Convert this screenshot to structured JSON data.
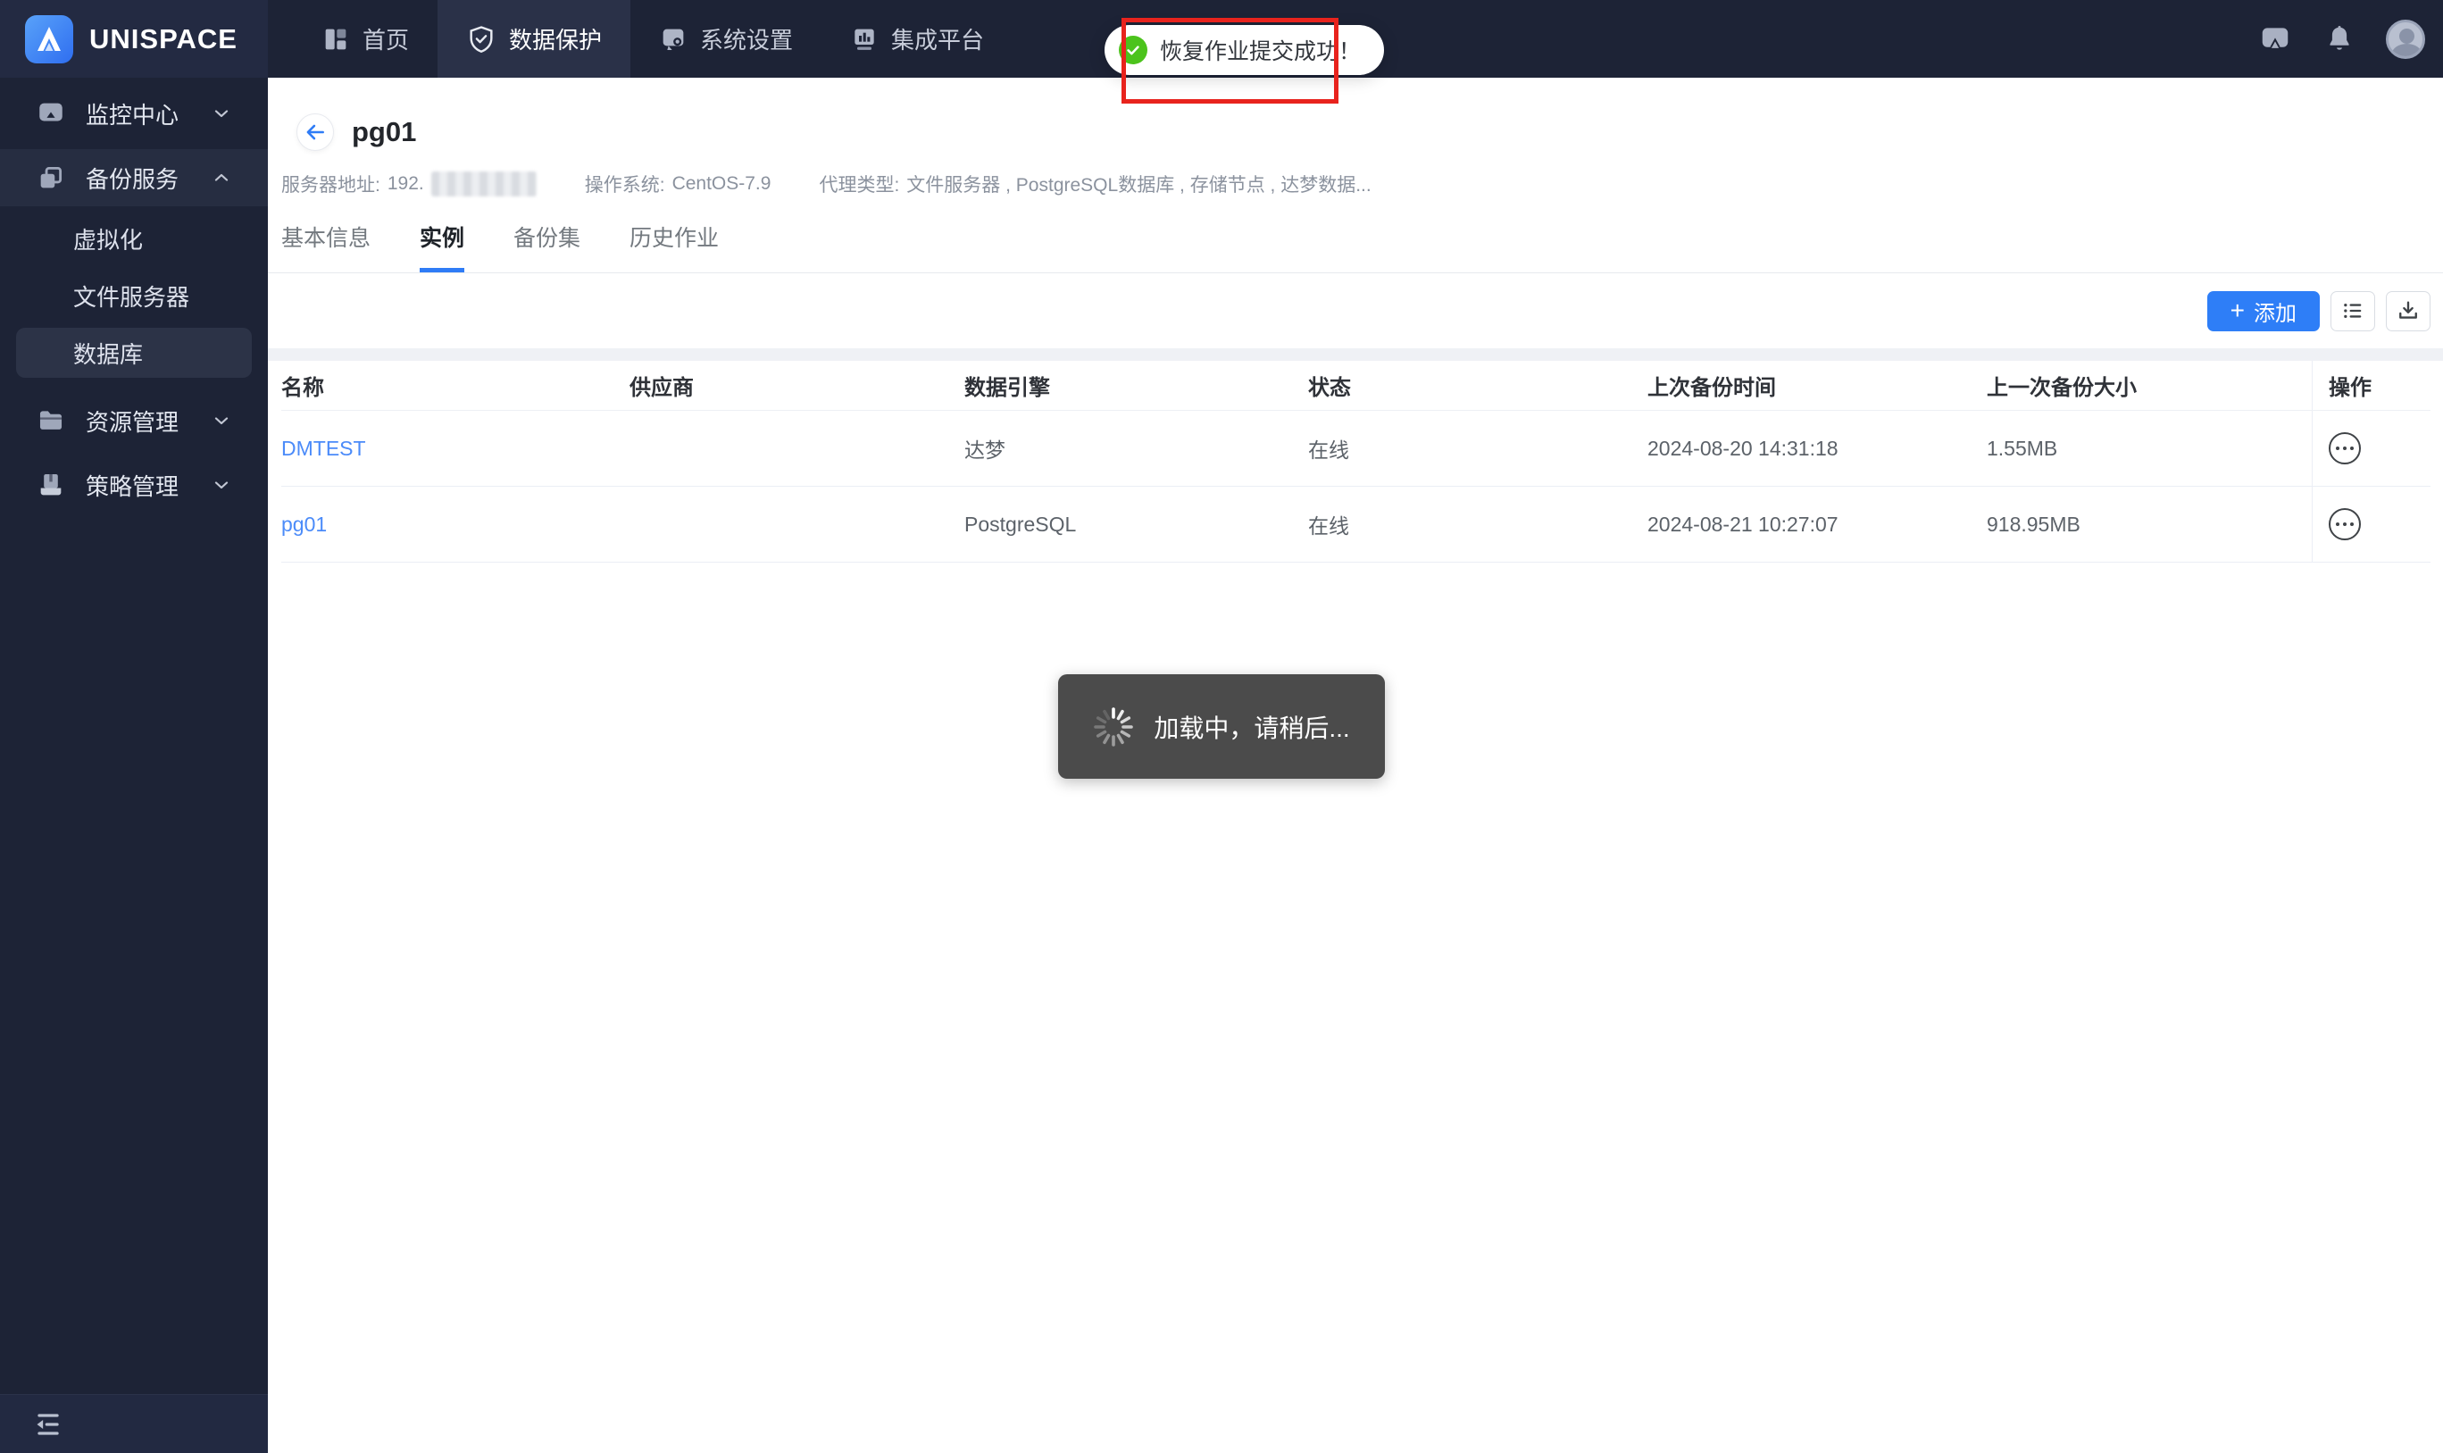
{
  "brand": {
    "name": "UNISPACE"
  },
  "topnav": {
    "items": [
      {
        "label": "首页",
        "active": false
      },
      {
        "label": "数据保护",
        "active": true
      },
      {
        "label": "系统设置",
        "active": false
      },
      {
        "label": "集成平台",
        "active": false
      }
    ]
  },
  "toast": {
    "message": "恢复作业提交成功！"
  },
  "sidebar": {
    "groups": [
      {
        "label": "监控中心",
        "state": "collapsed"
      },
      {
        "label": "备份服务",
        "state": "expanded",
        "children": [
          {
            "label": "虚拟化",
            "active": false
          },
          {
            "label": "文件服务器",
            "active": false
          },
          {
            "label": "数据库",
            "active": true
          }
        ]
      },
      {
        "label": "资源管理",
        "state": "collapsed"
      },
      {
        "label": "策略管理",
        "state": "collapsed"
      }
    ]
  },
  "page": {
    "title": "pg01",
    "info": {
      "server_label": "服务器地址:",
      "server_value_visible": "192.",
      "server_value_censored": true,
      "os_label": "操作系统:",
      "os_value": "CentOS-7.9",
      "agent_label": "代理类型:",
      "agent_value": "文件服务器 , PostgreSQL数据库 , 存储节点 , 达梦数据..."
    },
    "tabs": [
      {
        "label": "基本信息",
        "active": false
      },
      {
        "label": "实例",
        "active": true
      },
      {
        "label": "备份集",
        "active": false
      },
      {
        "label": "历史作业",
        "active": false
      }
    ],
    "toolbar": {
      "add_plus": "+",
      "add_label": "添加"
    }
  },
  "table": {
    "columns": [
      "名称",
      "供应商",
      "数据引擎",
      "状态",
      "上次备份时间",
      "上一次备份大小",
      "操作"
    ],
    "rows": [
      {
        "name": "DMTEST",
        "vendor": "",
        "engine": "达梦",
        "status": "在线",
        "last_backup_time": "2024-08-20 14:31:18",
        "last_backup_size": "1.55MB"
      },
      {
        "name": "pg01",
        "vendor": "",
        "engine": "PostgreSQL",
        "status": "在线",
        "last_backup_time": "2024-08-21 10:27:07",
        "last_backup_size": "918.95MB"
      }
    ]
  },
  "loading": {
    "message": "加载中，请稍后..."
  },
  "icons": {
    "logo": "mountain-A logo",
    "home": "dashboard-grid",
    "data-protection": "shield-check",
    "system-settings": "tool-block",
    "integration": "monitor-chart",
    "messages": "chat-bubble",
    "notifications": "bell",
    "operations": "ellipsis-in-circle",
    "collapse": "indent-collapse"
  },
  "colors": {
    "accent_blue": "#2e7ef7",
    "link_blue": "#4b8bf9",
    "success_green": "#4cc31c",
    "annotation_red": "#e8231d",
    "navbar_bg": "#1d2336",
    "loading_bg": "#444444"
  }
}
